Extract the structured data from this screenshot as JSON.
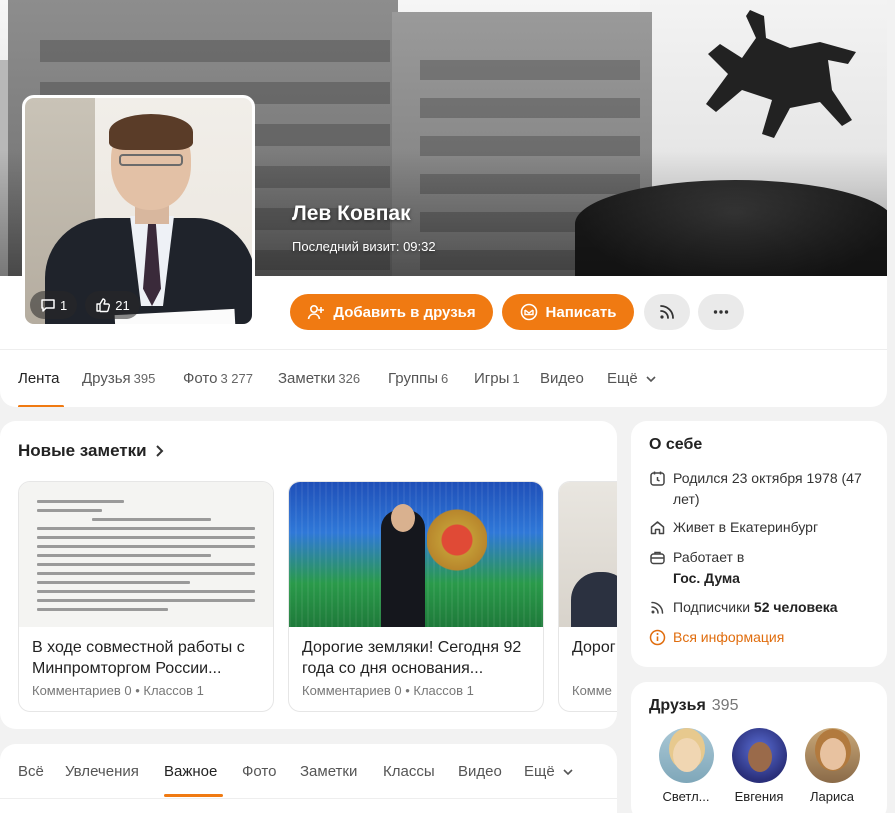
{
  "profile": {
    "name": "Лев Ковпак",
    "last_visit": "Последний визит: 09:32",
    "avatar_comments": "1",
    "avatar_likes": "21",
    "add_friend_label": "Добавить в друзья",
    "message_label": "Написать",
    "accent_color": "#f07a12"
  },
  "tabs": [
    {
      "label": "Лента",
      "count": ""
    },
    {
      "label": "Друзья",
      "count": "395"
    },
    {
      "label": "Фото",
      "count": "3 277"
    },
    {
      "label": "Заметки",
      "count": "326"
    },
    {
      "label": "Группы",
      "count": "6"
    },
    {
      "label": "Игры",
      "count": "1"
    },
    {
      "label": "Видео",
      "count": ""
    },
    {
      "label": "Ещё",
      "count": ""
    }
  ],
  "notes": {
    "title": "Новые заметки",
    "items": [
      {
        "title": "В ходе совместной работы с Минпромторгом России...",
        "meta": "Комментариев 0 • Классов 1"
      },
      {
        "title": "Дорогие земляки! Сегодня 92 года со дня основания...",
        "meta": "Комментариев 0 • Классов 1"
      },
      {
        "title": "Дорог вас со",
        "meta": "Комме"
      }
    ]
  },
  "feed_tabs": [
    "Всё",
    "Увлечения",
    "Важное",
    "Фото",
    "Заметки",
    "Классы",
    "Видео",
    "Ещё"
  ],
  "about": {
    "title": "О себе",
    "born": "Родился 23 октября 1978 (47 лет)",
    "lives": "Живет в Екатеринбург",
    "works_prefix": "Работает в",
    "works_place": "Гос. Дума",
    "subscribers_prefix": "Подписчики",
    "subscribers_count": "52 человека",
    "all_info": "Вся информация"
  },
  "friends": {
    "title": "Друзья",
    "count": "395",
    "items": [
      {
        "name": "Светл..."
      },
      {
        "name": "Евгения"
      },
      {
        "name": "Лариса"
      }
    ]
  }
}
